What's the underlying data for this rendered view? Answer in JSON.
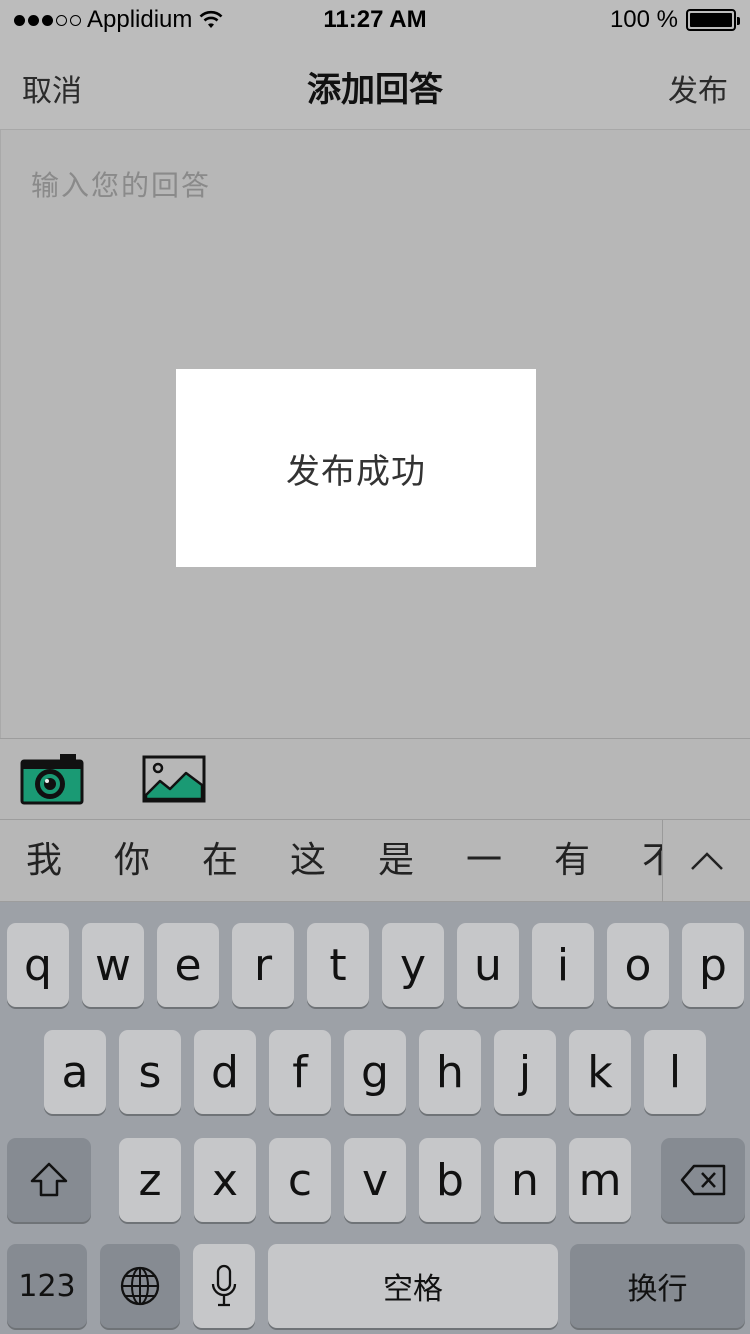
{
  "status_bar": {
    "carrier": "Applidium",
    "time": "11:27 AM",
    "battery": "100 %",
    "icons": [
      "signal-dots-icon",
      "wifi-icon",
      "battery-icon"
    ]
  },
  "nav": {
    "cancel_label": "取消",
    "title": "添加回答",
    "publish_label": "发布"
  },
  "editor": {
    "placeholder": "输入您的回答"
  },
  "toast": {
    "message": "发布成功"
  },
  "media_toolbar": {
    "icons": [
      "camera-icon",
      "image-icon"
    ],
    "accent_color": "#1a9a74"
  },
  "candidates": {
    "words": [
      "我",
      "你",
      "在",
      "这",
      "是",
      "一",
      "有",
      "不"
    ],
    "collapse_icon": "chevron-up-icon"
  },
  "keyboard": {
    "row1": [
      "q",
      "w",
      "e",
      "r",
      "t",
      "y",
      "u",
      "i",
      "o",
      "p"
    ],
    "row2": [
      "a",
      "s",
      "d",
      "f",
      "g",
      "h",
      "j",
      "k",
      "l"
    ],
    "row3": [
      "z",
      "x",
      "c",
      "v",
      "b",
      "n",
      "m"
    ],
    "numbers_label": "123",
    "space_label": "空格",
    "return_label": "换行",
    "icons": [
      "shift-icon",
      "backspace-icon",
      "globe-icon",
      "microphone-icon"
    ]
  }
}
